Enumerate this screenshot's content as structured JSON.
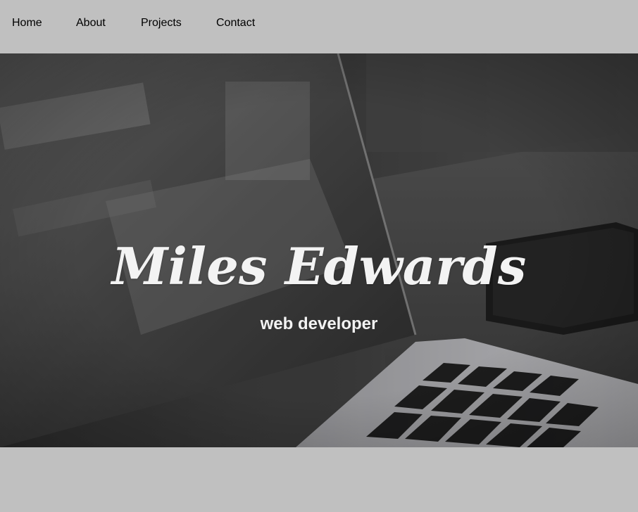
{
  "nav": {
    "items": [
      {
        "label": "Home"
      },
      {
        "label": "About"
      },
      {
        "label": "Projects"
      },
      {
        "label": "Contact"
      }
    ]
  },
  "hero": {
    "title": "Miles Edwards",
    "subtitle": "web developer",
    "background_image": "laptop-and-phone-on-desk-photo"
  },
  "colors": {
    "page_background": "#c0c0c0",
    "hero_text": "#f3f3f3",
    "nav_text": "#000000"
  }
}
